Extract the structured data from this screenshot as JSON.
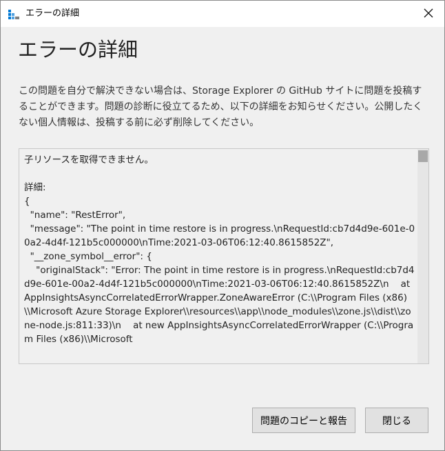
{
  "window": {
    "title": "エラーの詳細"
  },
  "dialog": {
    "heading": "エラーの詳細",
    "instructions": "この問題を自分で解決できない場合は、Storage Explorer の GitHub サイトに問題を投稿することができます。問題の診断に役立てるため、以下の詳細をお知らせください。公開したくない個人情報は、投稿する前に必ず削除してください。",
    "details_text": "子リソースを取得できません。\n\n詳細:\n{\n  \"name\": \"RestError\",\n  \"message\": \"The point in time restore is in progress.\\nRequestId:cb7d4d9e-601e-00a2-4d4f-121b5c000000\\nTime:2021-03-06T06:12:40.8615852Z\",\n  \"__zone_symbol__error\": {\n    \"originalStack\": \"Error: The point in time restore is in progress.\\nRequestId:cb7d4d9e-601e-00a2-4d4f-121b5c000000\\nTime:2021-03-06T06:12:40.8615852Z\\n    at AppInsightsAsyncCorrelatedErrorWrapper.ZoneAwareError (C:\\\\Program Files (x86)\\\\Microsoft Azure Storage Explorer\\\\resources\\\\app\\\\node_modules\\\\zone.js\\\\dist\\\\zone-node.js:811:33)\\n    at new AppInsightsAsyncCorrelatedErrorWrapper (C:\\\\Program Files (x86)\\\\Microsoft"
  },
  "buttons": {
    "copy_report": "問題のコピーと報告",
    "close": "閉じる"
  },
  "icons": {
    "app": "storage-explorer-icon",
    "close": "close-icon"
  },
  "colors": {
    "dialog_background": "#f0f0f0",
    "titlebar_background": "#ffffff",
    "app_icon_blue": "#0078d4"
  }
}
